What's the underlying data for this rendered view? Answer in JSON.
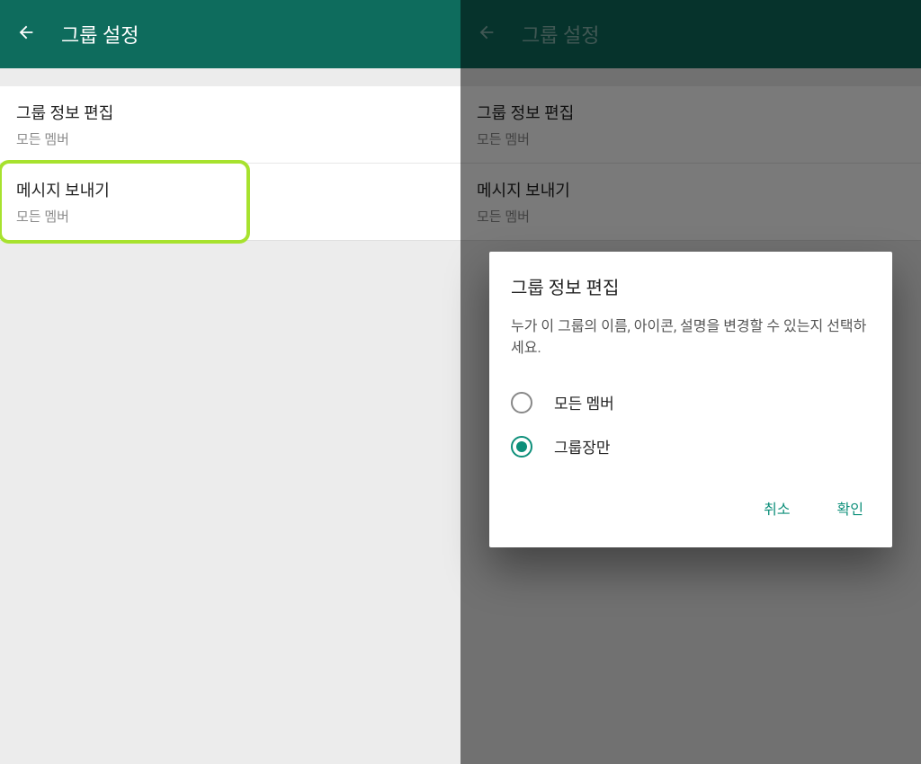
{
  "left": {
    "title": "그룹 설정",
    "items": [
      {
        "title": "그룹 정보 편집",
        "subtitle": "모든 멤버"
      },
      {
        "title": "메시지 보내기",
        "subtitle": "모든 멤버"
      }
    ]
  },
  "right": {
    "title": "그룹 설정",
    "items": [
      {
        "title": "그룹 정보 편집",
        "subtitle": "모든 멤버"
      },
      {
        "title": "메시지 보내기",
        "subtitle": "모든 멤버"
      }
    ],
    "dialog": {
      "title": "그룹 정보 편집",
      "description": "누가 이 그룹의 이름, 아이콘, 설명을 변경할 수 있는지 선택하세요.",
      "options": [
        {
          "label": "모든 멤버",
          "selected": false
        },
        {
          "label": "그룹장만",
          "selected": true
        }
      ],
      "cancel": "취소",
      "confirm": "확인"
    }
  }
}
